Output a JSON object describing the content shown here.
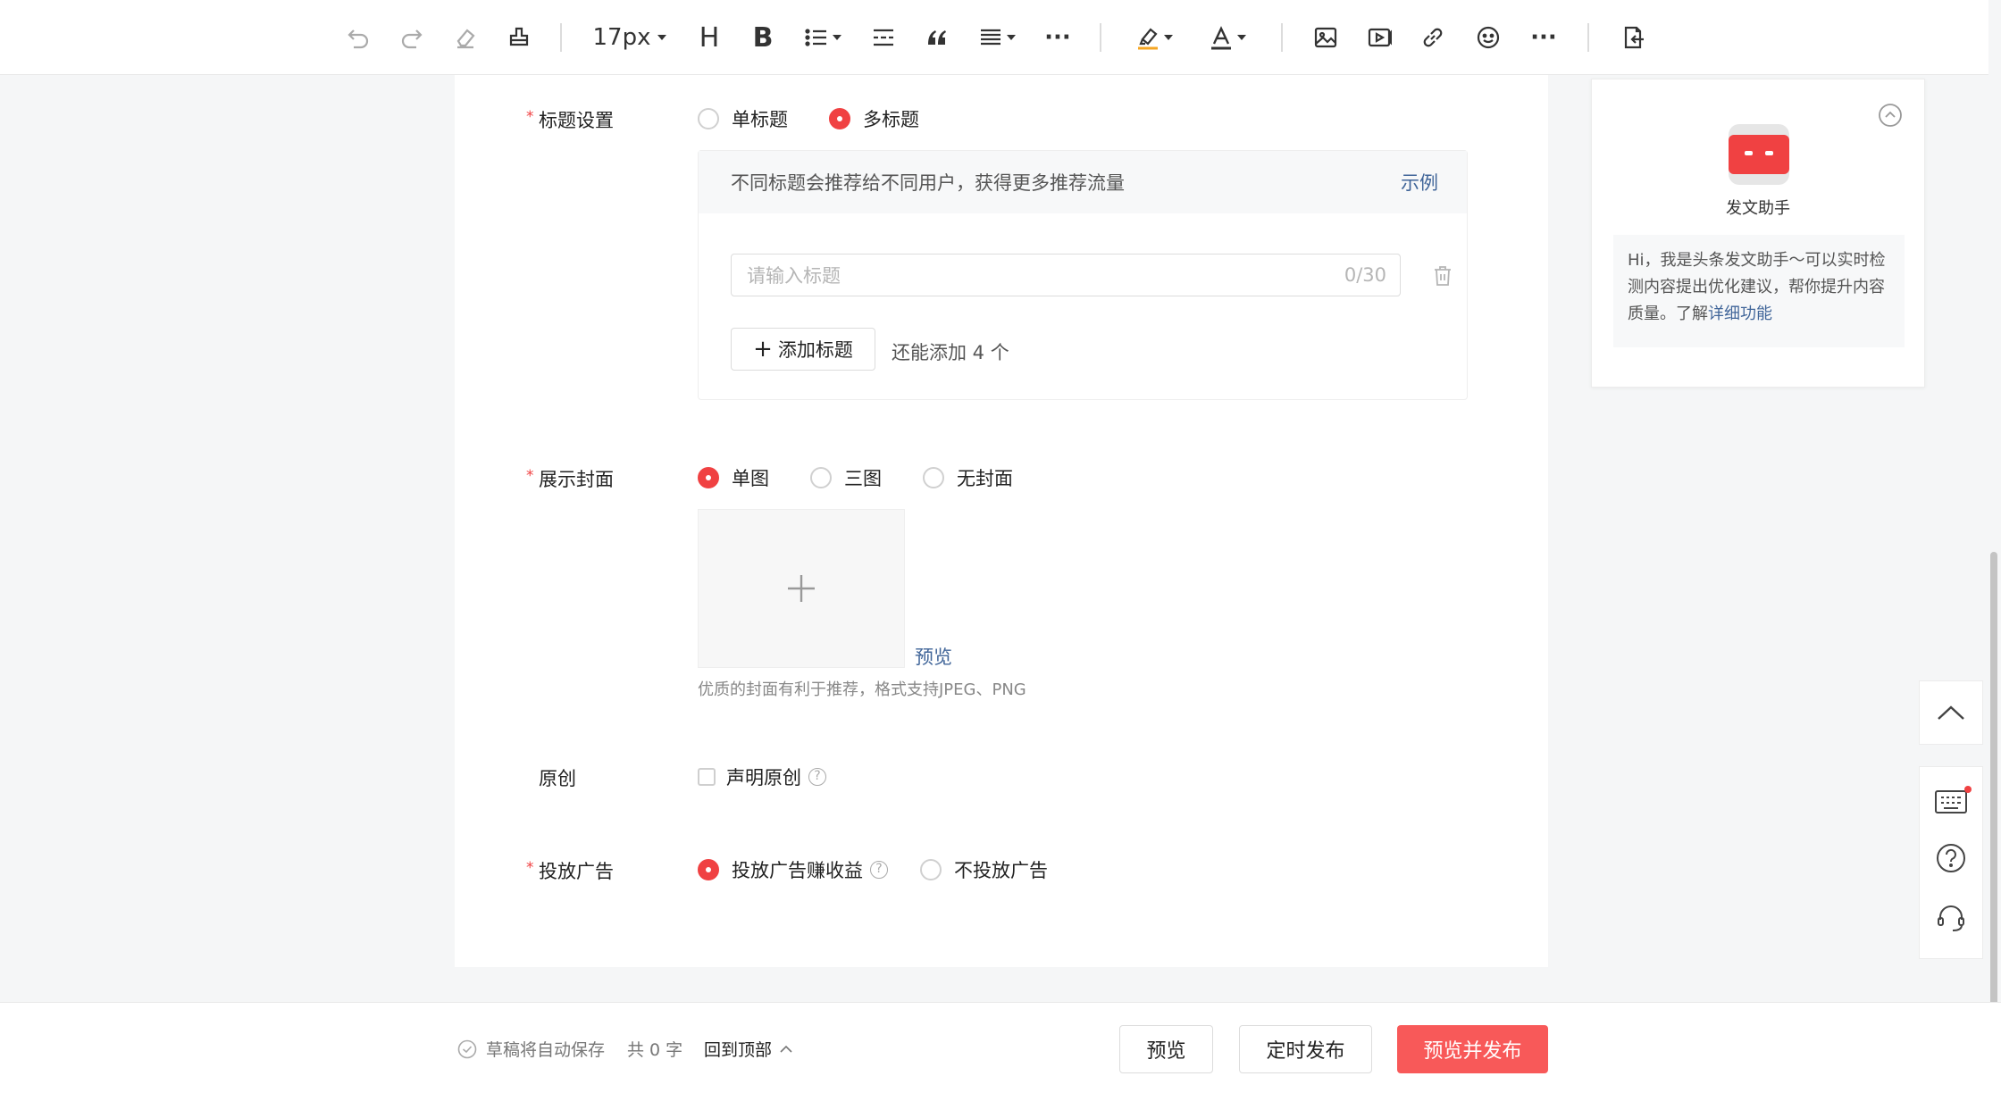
{
  "toolbar": {
    "font_size": "17px",
    "heading_label": "H",
    "bold_label": "B",
    "more_label": "···",
    "more2_label": "···"
  },
  "title_settings": {
    "label": "标题设置",
    "required_mark": "*",
    "options": [
      "单标题",
      "多标题"
    ],
    "selected": "多标题",
    "hint": "不同标题会推荐给不同用户，获得更多推荐流量",
    "example_link": "示例",
    "input_placeholder": "请输入标题",
    "input_counter": "0/30",
    "add_button": "添加标题",
    "add_remaining": "还能添加 4 个"
  },
  "cover": {
    "label": "展示封面",
    "required_mark": "*",
    "options": [
      "单图",
      "三图",
      "无封面"
    ],
    "selected": "单图",
    "preview_link": "预览",
    "tip": "优质的封面有利于推荐，格式支持JPEG、PNG"
  },
  "original": {
    "label": "原创",
    "checkbox_label": "声明原创",
    "checked": false
  },
  "ads": {
    "label": "投放广告",
    "required_mark": "*",
    "options": [
      "投放广告赚收益",
      "不投放广告"
    ],
    "selected": "投放广告赚收益"
  },
  "assistant": {
    "name": "发文助手",
    "message": "Hi，我是头条发文助手～可以实时检测内容提出优化建议，帮你提升内容质量。了解",
    "link": "详细功能"
  },
  "bottom_bar": {
    "autosave": "草稿将自动保存",
    "word_count": "共 0 字",
    "back_to_top": "回到顶部",
    "preview_button": "预览",
    "schedule_button": "定时发布",
    "publish_button": "预览并发布"
  },
  "colors": {
    "accent": "#f04142",
    "link": "#406599",
    "publish_button": "#f85959"
  }
}
